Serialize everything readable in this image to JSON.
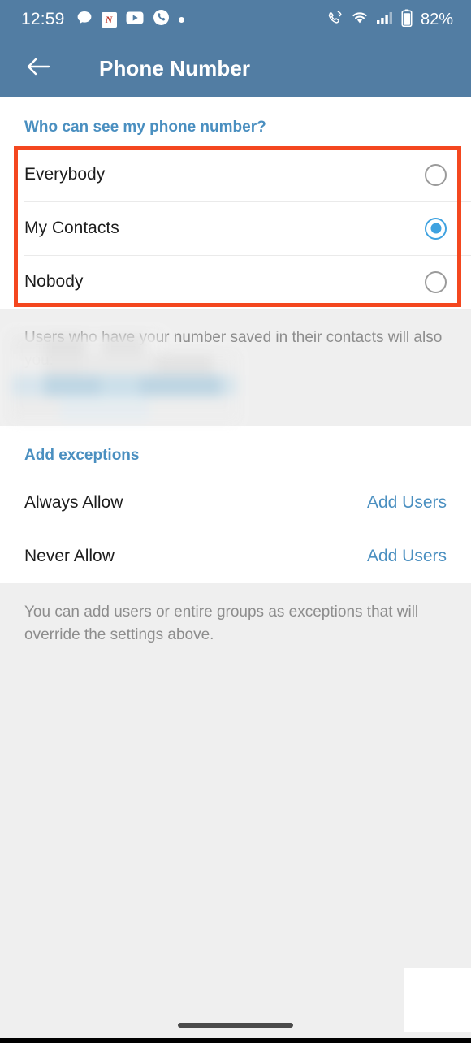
{
  "statusbar": {
    "time": "12:59",
    "battery_percent": "82%",
    "left_icons": [
      "chat-bubble-icon",
      "note-app-icon",
      "youtube-icon",
      "phone-call-icon",
      "dot-icon"
    ],
    "note_app_glyph": "N",
    "right_icons": [
      "call-mute-icon",
      "wifi-icon",
      "signal-icon",
      "battery-icon"
    ]
  },
  "appbar": {
    "back_icon": "arrow-left-icon",
    "title": "Phone Number"
  },
  "visibility_section": {
    "header": "Who can see my phone number?",
    "options": [
      {
        "label": "Everybody",
        "selected": false
      },
      {
        "label": "My Contacts",
        "selected": true
      },
      {
        "label": "Nobody",
        "selected": false
      }
    ],
    "note": "Users who have your number saved in their contacts will also  you:"
  },
  "exceptions_section": {
    "header": "Add exceptions",
    "rows": [
      {
        "label": "Always Allow",
        "action": "Add Users"
      },
      {
        "label": "Never Allow",
        "action": "Add Users"
      }
    ],
    "note": "You can add users or entire groups as exceptions that will override the settings above."
  },
  "colors": {
    "appbar": "#527da3",
    "accent": "#4a8fc0",
    "radio_selected": "#3fa2e0",
    "highlight": "#f4471f",
    "page_bg": "#efefef",
    "card_bg": "#ffffff"
  },
  "navbar": {
    "pill": "gesture-home-pill"
  }
}
